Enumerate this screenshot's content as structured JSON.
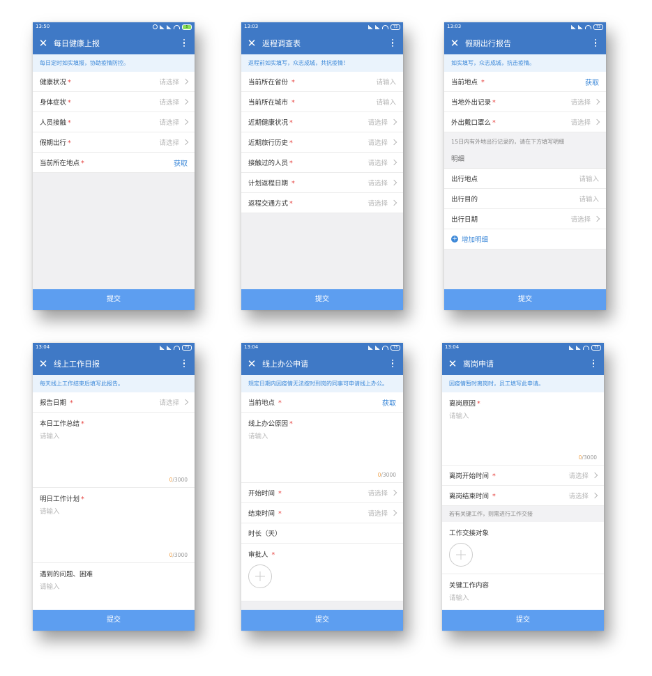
{
  "common": {
    "submit": "提交",
    "select_ph": "请选择",
    "input_ph": "请输入",
    "fetch": "获取",
    "star": "*",
    "counter_num": "0",
    "counter_max": "/3000"
  },
  "p1": {
    "time": "13:50",
    "battery": "5",
    "title": "每日健康上报",
    "banner": "每日定时如实填报，协助疫情防控。",
    "rows": [
      "健康状况",
      "身体症状",
      "人员接触",
      "假期出行"
    ],
    "location": "当前所在地点"
  },
  "p2": {
    "time": "13:03",
    "battery": "73",
    "title": "返程调查表",
    "banner": "返程前如实填写，众志成城，共抗疫情！",
    "province": "当前所在省份",
    "city": "当前所在城市",
    "rows": [
      "近期健康状况",
      "近期旅行历史",
      "接触过的人员",
      "计划返程日期",
      "返程交通方式"
    ]
  },
  "p3": {
    "time": "13:03",
    "battery": "73",
    "title": "假期出行报告",
    "banner": "如实填写，众志成城，抗击疫情。",
    "location": "当前地点",
    "rows": [
      "当地外出记录",
      "外出戴口罩么"
    ],
    "note": "15日内有外地出行记录的，请在下方填写明细",
    "detail_header": "明细",
    "place": "出行地点",
    "purpose": "出行目的",
    "date": "出行日期",
    "add": "增加明细"
  },
  "p4": {
    "time": "13:04",
    "battery": "73",
    "title": "线上工作日报",
    "banner": "每天线上工作结束后填写此报告。",
    "report_date": "报告日期",
    "summary": "本日工作总结",
    "plan": "明日工作计划",
    "problems": "遇到的问题、困难"
  },
  "p5": {
    "time": "13:04",
    "battery": "73",
    "title": "线上办公申请",
    "banner": "规定日期内因疫情无法按时到岗的同事可申请线上办公。",
    "location": "当前地点",
    "reason": "线上办公原因",
    "start": "开始时间",
    "end": "结束时间",
    "duration": "时长（天）",
    "approver": "审批人"
  },
  "p6": {
    "time": "13:04",
    "battery": "73",
    "title": "离岗申请",
    "banner": "因疫情暂时离岗时，员工填写此申请。",
    "reason": "离岗原因",
    "start": "离岗开始时间",
    "end": "离岗结束时间",
    "note": "若有关键工作，则需进行工作交接",
    "handover": "工作交接对象",
    "key_work": "关键工作内容"
  }
}
